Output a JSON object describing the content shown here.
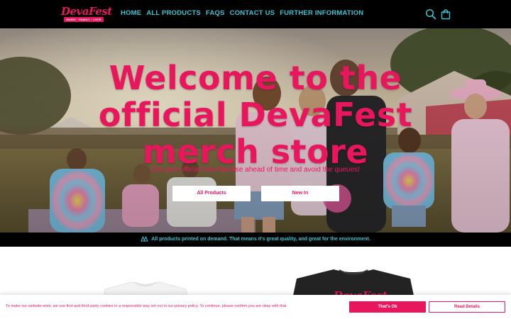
{
  "brand": {
    "logo_text": "DevaFest",
    "tagline": "MUSIC · FAMILY · LOVE"
  },
  "nav": {
    "items": [
      "HOME",
      "ALL PRODUCTS",
      "FAQS",
      "CONTACT US",
      "FURTHER INFORMATION"
    ]
  },
  "header_icons": [
    "search-icon",
    "shopping-bag-icon"
  ],
  "hero": {
    "title": "Welcome to the official DevaFest merch store",
    "subtitle": "Get your official merchandise ahead of time and avoid the queues!",
    "buttons": [
      "All Products",
      "New In"
    ]
  },
  "info_bar": {
    "text": "All products printed on demand. That means it's great quality, and great for the environment."
  },
  "product_preview": {
    "shirt_print": "DevaFest"
  },
  "cookie_banner": {
    "text": "To make our website work, we use first and third-party cookies in a responsible way set out in our privacy policy. To continue, please confirm you are okay with that.",
    "accept_label": "That's Ok",
    "details_label": "Read Details"
  },
  "colors": {
    "brand_pink": "#e8175d",
    "nav_teal": "#39c6d3",
    "header_bg": "#000000"
  }
}
